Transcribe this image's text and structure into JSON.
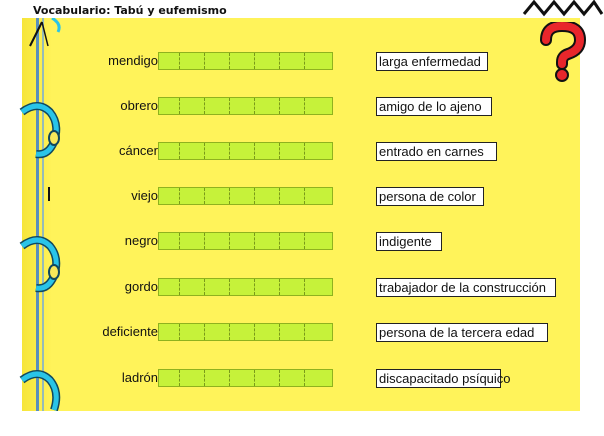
{
  "app": {
    "title": "Vocabulario: Tabú y eufemismo",
    "logo_icon": "zigzag-logo-icon",
    "help_icon": "question-mark-icon"
  },
  "colors": {
    "board": "#fff35a",
    "slot": "#c6f23a",
    "ring": "#29c4e8",
    "question_mark": "#e8262b"
  },
  "words": [
    {
      "label": "mendigo"
    },
    {
      "label": "obrero"
    },
    {
      "label": "cáncer"
    },
    {
      "label": "viejo"
    },
    {
      "label": "negro"
    },
    {
      "label": "gordo"
    },
    {
      "label": "deficiente"
    },
    {
      "label": "ladrón"
    }
  ],
  "options": [
    {
      "label": "larga enfermedad"
    },
    {
      "label": "amigo de lo ajeno"
    },
    {
      "label": "entrado en carnes"
    },
    {
      "label": "persona de color"
    },
    {
      "label": "indigente"
    },
    {
      "label": "trabajador de la construcción"
    },
    {
      "label": "persona de la tercera edad"
    },
    {
      "label": "discapacitado psíquico"
    }
  ]
}
